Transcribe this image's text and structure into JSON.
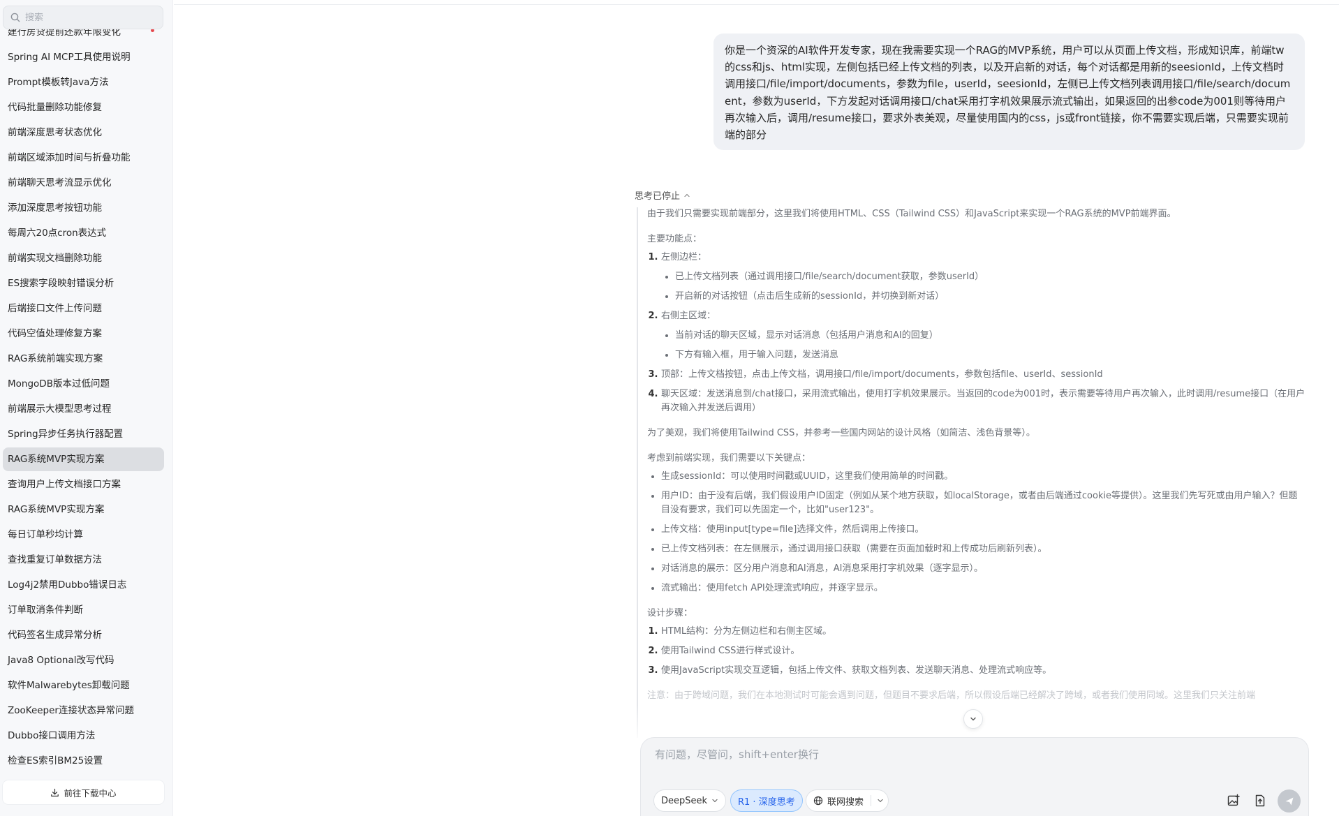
{
  "search": {
    "placeholder": "搜索"
  },
  "sessions": [
    {
      "label": "建行房贷提前还款年限变化"
    },
    {
      "label": "Spring AI MCP工具使用说明"
    },
    {
      "label": "Prompt模板转Java方法"
    },
    {
      "label": "代码批量删除功能修复"
    },
    {
      "label": "前端深度思考状态优化"
    },
    {
      "label": "前端区域添加时间与折叠功能"
    },
    {
      "label": "前端聊天思考流显示优化"
    },
    {
      "label": "添加深度思考按钮功能"
    },
    {
      "label": "每周六20点cron表达式"
    },
    {
      "label": "前端实现文档删除功能"
    },
    {
      "label": "ES搜索字段映射错误分析"
    },
    {
      "label": "后端接口文件上传问题"
    },
    {
      "label": "代码空值处理修复方案"
    },
    {
      "label": "RAG系统前端实现方案"
    },
    {
      "label": "MongoDB版本过低问题"
    },
    {
      "label": "前端展示大模型思考过程"
    },
    {
      "label": "Spring异步任务执行器配置"
    },
    {
      "label": "RAG系统MVP实现方案",
      "active": true
    },
    {
      "label": "查询用户上传文档接口方案"
    },
    {
      "label": "RAG系统MVP实现方案"
    },
    {
      "label": "每日订单秒均计算"
    },
    {
      "label": "查找重复订单数据方法"
    },
    {
      "label": "Log4j2禁用Dubbo错误日志"
    },
    {
      "label": "订单取消条件判断"
    },
    {
      "label": "代码签名生成异常分析"
    },
    {
      "label": "Java8 Optional改写代码"
    },
    {
      "label": "软件Malwarebytes卸载问题"
    },
    {
      "label": "ZooKeeper连接状态异常问题"
    },
    {
      "label": "Dubbo接口调用方法"
    },
    {
      "label": "检查ES索引BM25设置"
    }
  ],
  "download": {
    "label": "前往下载中心",
    "icon": "download-icon"
  },
  "user_message": "你是一个资深的AI软件开发专家，现在我需要实现一个RAG的MVP系统，用户可以从页面上传文档，形成知识库，前端tw的css和js、html实现，左侧包括已经上传文档的列表，以及开启新的对话，每个对话都是用新的seesionId，上传文档时调用接口/file/import/documents，参数为file，userId，seesionId，左侧已上传文档列表调用接口/file/search/document，参数为userId，下方发起对话调用接口/chat采用打字机效果展示流式输出，如果返回的出参code为001则等待用户再次输入后，调用/resume接口，要求外表美观，尽量使用国内的css，js或front链接，你不需要实现后端，只需要实现前端的部分",
  "thinking": {
    "header": "思考已停止",
    "intro": "由于我们只需要实现前端部分，这里我们将使用HTML、CSS（Tailwind CSS）和JavaScript来实现一个RAG系统的MVP前端界面。",
    "features_title": "主要功能点：",
    "features": [
      {
        "text": "左侧边栏：",
        "subs": [
          "已上传文档列表（通过调用接口/file/search/document获取，参数userId）",
          "开启新的对话按钮（点击后生成新的sessionId，并切换到新对话）"
        ]
      },
      {
        "text": "右侧主区域：",
        "subs": [
          "当前对话的聊天区域，显示对话消息（包括用户消息和AI的回复）",
          "下方有输入框，用于输入问题，发送消息"
        ]
      },
      {
        "text": "顶部：上传文档按钮，点击上传文档，调用接口/file/import/documents，参数包括file、userId、sessionId",
        "subs": []
      },
      {
        "text": "聊天区域：发送消息到/chat接口，采用流式输出，使用打字机效果展示。当返回的code为001时，表示需要等待用户再次输入，此时调用/resume接口（在用户再次输入并发送后调用）",
        "subs": []
      }
    ],
    "design_note": "为了美观，我们将使用Tailwind CSS，并参考一些国内网站的设计风格（如简洁、浅色背景等）。",
    "key_title": "考虑到前端实现，我们需要以下关键点：",
    "key_points": [
      "生成sessionId：可以使用时间戳或UUID，这里我们使用简单的时间戳。",
      "用户ID：由于没有后端，我们假设用户ID固定（例如从某个地方获取，如localStorage，或者由后端通过cookie等提供）。这里我们先写死或由用户输入？但题目没有要求，我们可以先固定一个，比如\"user123\"。",
      "上传文档：使用input[type=file]选择文件，然后调用上传接口。",
      "已上传文档列表：在左侧展示，通过调用接口获取（需要在页面加载时和上传成功后刷新列表）。",
      "对话消息的展示：区分用户消息和AI消息，AI消息采用打字机效果（逐字显示）。",
      "流式输出：使用fetch API处理流式响应，并逐字显示。"
    ],
    "steps_title": "设计步骤：",
    "steps": [
      "HTML结构：分为左侧边栏和右侧主区域。",
      "使用Tailwind CSS进行样式设计。",
      "使用JavaScript实现交互逻辑，包括上传文件、获取文档列表、发送聊天消息、处理流式响应等。"
    ],
    "faded": "注意：由于跨域问题，我们在本地测试时可能会遇到问题，但题目不要求后端，所以假设后端已经解决了跨域，或者我们使用同域。这里我们只关注前端"
  },
  "composer": {
    "placeholder": "有问题，尽管问，shift+enter换行",
    "model_label": "DeepSeek",
    "deep_think_label": "R1 · 深度思考",
    "web_search_label": "联网搜索"
  },
  "colors": {
    "accent": "#2563eb",
    "active_chip_bg": "#dbeafe",
    "sidebar_bg": "#f7f8fa",
    "active_item_bg": "#dcdee2",
    "bubble_bg": "#eff1f5"
  }
}
